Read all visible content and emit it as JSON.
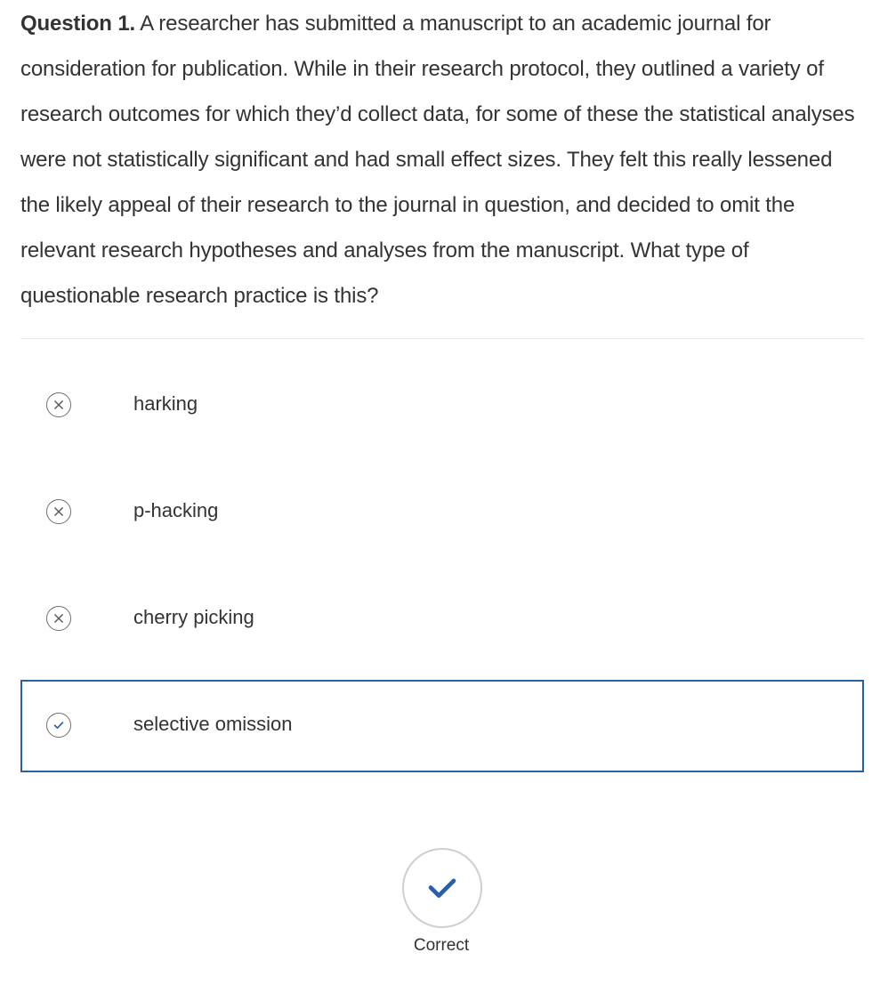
{
  "question": {
    "label": "Question 1.",
    "text": "A researcher has submitted a manuscript to an academic journal for consideration for publication. While in their research protocol, they outlined a variety of research outcomes for which they’d collect data, for some of these the statistical analyses were not statistically significant and had small effect sizes. They felt this really lessened the likely appeal of their research to the journal in question, and decided to omit the relevant research hypotheses and analyses from the manuscript. What type of questionable research practice is this?"
  },
  "options": [
    {
      "label": "harking",
      "status": "incorrect",
      "icon": "x-circle-icon"
    },
    {
      "label": "p-hacking",
      "status": "incorrect",
      "icon": "x-circle-icon"
    },
    {
      "label": "cherry picking",
      "status": "incorrect",
      "icon": "x-circle-icon"
    },
    {
      "label": "selective omission",
      "status": "correct",
      "icon": "check-circle-icon"
    }
  ],
  "result": {
    "label": "Correct",
    "icon": "checkmark-icon"
  },
  "colors": {
    "accent": "#2b5fa8",
    "text": "#333333",
    "divider": "#e8e8e8",
    "incorrect_icon": "#6f6f6f"
  }
}
